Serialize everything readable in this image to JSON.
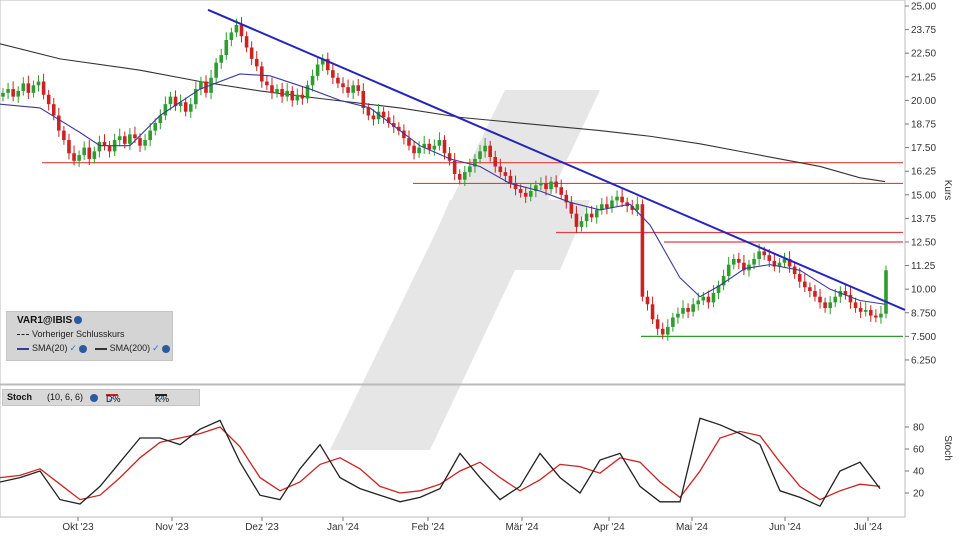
{
  "chart_data": [
    {
      "type": "candlestick",
      "symbol": "VAR1@IBIS",
      "ylabel": "Kurs",
      "ylim": [
        5.4,
        25.0
      ],
      "y_ticks": [
        "25.00",
        "23.75",
        "22.50",
        "21.25",
        "20.00",
        "18.75",
        "17.50",
        "16.25",
        "15.00",
        "13.75",
        "12.50",
        "11.25",
        "10.00",
        "8.750",
        "7.500",
        "6.250"
      ],
      "x_ticks": [
        "Okt '23",
        "Nov '23",
        "Dez '23",
        "Jan '24",
        "Feb '24",
        "Mär '24",
        "Apr '24",
        "Mai '24",
        "Jun '24",
        "Jul '24"
      ],
      "legend": {
        "previous_close_label": "Vorheriger Schlusskurs",
        "sma20_label": "SMA(20)",
        "sma200_label": "SMA(200)"
      },
      "colors": {
        "up": "#2e9c2e",
        "down": "#cc2222",
        "sma20": "#3a3a9a",
        "sma200": "#333333",
        "trendline": "#2424c0",
        "resistance": "#e04040",
        "support": "#2aa02a"
      },
      "closes": [
        20.4,
        20.6,
        20.2,
        20.5,
        20.9,
        20.4,
        20.8,
        21.0,
        20.3,
        19.8,
        19.2,
        18.4,
        17.9,
        17.2,
        16.8,
        17.1,
        17.5,
        16.9,
        17.3,
        17.8,
        17.6,
        17.3,
        17.9,
        18.1,
        17.7,
        18.2,
        18.0,
        17.6,
        17.9,
        18.4,
        18.8,
        19.2,
        19.8,
        20.2,
        19.7,
        19.9,
        19.4,
        19.8,
        20.6,
        21.0,
        20.4,
        21.2,
        22.0,
        22.4,
        23.2,
        23.6,
        24.0,
        23.4,
        22.8,
        22.2,
        21.8,
        21.0,
        20.8,
        20.4,
        20.6,
        20.2,
        20.5,
        20.0,
        20.3,
        20.1,
        20.8,
        21.3,
        21.9,
        22.2,
        21.6,
        21.2,
        20.9,
        20.7,
        20.4,
        20.8,
        20.5,
        19.6,
        19.2,
        19.0,
        19.4,
        19.1,
        18.8,
        18.6,
        18.4,
        18.0,
        17.6,
        17.2,
        17.5,
        17.7,
        17.4,
        17.6,
        17.9,
        17.2,
        16.8,
        16.1,
        15.8,
        16.2,
        16.5,
        16.9,
        17.3,
        17.6,
        17.0,
        16.5,
        16.2,
        16.0,
        15.6,
        15.3,
        15.1,
        14.9,
        15.2,
        15.5,
        15.6,
        15.3,
        15.7,
        15.4,
        15.0,
        14.6,
        14.0,
        13.3,
        13.6,
        14.0,
        13.8,
        14.2,
        14.5,
        14.3,
        14.7,
        14.9,
        14.6,
        14.4,
        14.2,
        14.5,
        9.6,
        9.2,
        8.4,
        7.9,
        7.6,
        8.0,
        8.5,
        8.7,
        9.0,
        8.8,
        9.2,
        9.4,
        9.6,
        9.3,
        9.8,
        10.2,
        10.7,
        11.3,
        11.6,
        11.4,
        11.0,
        11.3,
        11.6,
        12.0,
        11.8,
        11.5,
        11.2,
        11.4,
        11.6,
        11.2,
        10.8,
        10.4,
        10.1,
        9.9,
        9.6,
        9.3,
        9.0,
        9.3,
        9.6,
        9.9,
        9.7,
        9.3,
        9.0,
        8.8,
        8.9,
        8.6,
        8.5,
        8.7,
        11.0
      ],
      "sma20": [
        [
          0,
          19.8
        ],
        [
          40,
          19.6
        ],
        [
          80,
          18.3
        ],
        [
          100,
          17.6
        ],
        [
          130,
          17.6
        ],
        [
          160,
          19.2
        ],
        [
          200,
          20.6
        ],
        [
          240,
          21.4
        ],
        [
          270,
          21.3
        ],
        [
          310,
          20.6
        ],
        [
          340,
          20.0
        ],
        [
          370,
          19.6
        ],
        [
          400,
          18.4
        ],
        [
          420,
          17.6
        ],
        [
          450,
          16.9
        ],
        [
          480,
          16.5
        ],
        [
          510,
          15.6
        ],
        [
          540,
          15.2
        ],
        [
          570,
          14.6
        ],
        [
          600,
          14.2
        ],
        [
          630,
          14.5
        ],
        [
          650,
          13.4
        ],
        [
          680,
          10.6
        ],
        [
          700,
          9.6
        ],
        [
          720,
          10.2
        ],
        [
          745,
          11.1
        ],
        [
          770,
          11.3
        ],
        [
          800,
          11.0
        ],
        [
          830,
          10.0
        ],
        [
          860,
          9.4
        ],
        [
          885,
          9.2
        ]
      ],
      "sma200": [
        [
          0,
          23.0
        ],
        [
          60,
          22.2
        ],
        [
          140,
          21.6
        ],
        [
          200,
          21.0
        ],
        [
          260,
          20.5
        ],
        [
          320,
          20.1
        ],
        [
          400,
          19.6
        ],
        [
          460,
          19.1
        ],
        [
          520,
          18.8
        ],
        [
          560,
          18.6
        ],
        [
          600,
          18.4
        ],
        [
          650,
          18.1
        ],
        [
          700,
          17.7
        ],
        [
          740,
          17.3
        ],
        [
          780,
          16.9
        ],
        [
          820,
          16.5
        ],
        [
          860,
          15.9
        ],
        [
          885,
          15.7
        ]
      ],
      "trendline": {
        "from": [
          208,
          24.8
        ],
        "to": [
          905,
          8.9
        ]
      },
      "resistance_levels": [
        {
          "value": 16.7,
          "from_x": 42,
          "to_x": 903
        },
        {
          "value": 15.6,
          "from_x": 413,
          "to_x": 903
        },
        {
          "value": 13.0,
          "from_x": 556,
          "to_x": 903
        },
        {
          "value": 12.5,
          "from_x": 664,
          "to_x": 903
        }
      ],
      "support_levels": [
        {
          "value": 7.5,
          "from_x": 641,
          "to_x": 903
        }
      ]
    },
    {
      "type": "line",
      "title": "Stoch",
      "params": "(10, 6, 6)",
      "ylabel": "Stoch",
      "ylim": [
        0,
        100
      ],
      "y_ticks": [
        "80",
        "60",
        "40",
        "20"
      ],
      "series": [
        {
          "name": "D%",
          "color": "#cc2222",
          "values": [
            [
              0,
              34
            ],
            [
              20,
              36
            ],
            [
              40,
              42
            ],
            [
              60,
              28
            ],
            [
              80,
              14
            ],
            [
              100,
              18
            ],
            [
              120,
              34
            ],
            [
              140,
              52
            ],
            [
              160,
              66
            ],
            [
              180,
              70
            ],
            [
              200,
              74
            ],
            [
              220,
              80
            ],
            [
              240,
              62
            ],
            [
              260,
              34
            ],
            [
              280,
              22
            ],
            [
              300,
              30
            ],
            [
              320,
              46
            ],
            [
              340,
              52
            ],
            [
              360,
              42
            ],
            [
              380,
              26
            ],
            [
              400,
              20
            ],
            [
              420,
              22
            ],
            [
              440,
              28
            ],
            [
              460,
              40
            ],
            [
              480,
              48
            ],
            [
              500,
              34
            ],
            [
              520,
              22
            ],
            [
              540,
              32
            ],
            [
              560,
              46
            ],
            [
              580,
              44
            ],
            [
              600,
              38
            ],
            [
              620,
              52
            ],
            [
              640,
              48
            ],
            [
              660,
              30
            ],
            [
              680,
              16
            ],
            [
              700,
              40
            ],
            [
              720,
              70
            ],
            [
              740,
              76
            ],
            [
              760,
              72
            ],
            [
              780,
              48
            ],
            [
              800,
              26
            ],
            [
              820,
              14
            ],
            [
              840,
              22
            ],
            [
              860,
              28
            ],
            [
              880,
              26
            ]
          ]
        },
        {
          "name": "K%",
          "color": "#222222",
          "values": [
            [
              0,
              30
            ],
            [
              20,
              34
            ],
            [
              40,
              40
            ],
            [
              60,
              14
            ],
            [
              80,
              10
            ],
            [
              100,
              26
            ],
            [
              120,
              48
            ],
            [
              140,
              70
            ],
            [
              160,
              70
            ],
            [
              180,
              64
            ],
            [
              200,
              78
            ],
            [
              220,
              86
            ],
            [
              240,
              48
            ],
            [
              260,
              18
            ],
            [
              280,
              14
            ],
            [
              300,
              42
            ],
            [
              320,
              64
            ],
            [
              340,
              34
            ],
            [
              360,
              24
            ],
            [
              380,
              18
            ],
            [
              400,
              12
            ],
            [
              420,
              16
            ],
            [
              440,
              24
            ],
            [
              460,
              56
            ],
            [
              480,
              34
            ],
            [
              500,
              14
            ],
            [
              520,
              26
            ],
            [
              540,
              56
            ],
            [
              560,
              34
            ],
            [
              580,
              20
            ],
            [
              600,
              50
            ],
            [
              620,
              56
            ],
            [
              640,
              26
            ],
            [
              660,
              12
            ],
            [
              680,
              12
            ],
            [
              700,
              88
            ],
            [
              720,
              82
            ],
            [
              740,
              74
            ],
            [
              760,
              64
            ],
            [
              780,
              22
            ],
            [
              800,
              16
            ],
            [
              820,
              8
            ],
            [
              840,
              40
            ],
            [
              860,
              48
            ],
            [
              880,
              24
            ]
          ]
        }
      ]
    }
  ]
}
